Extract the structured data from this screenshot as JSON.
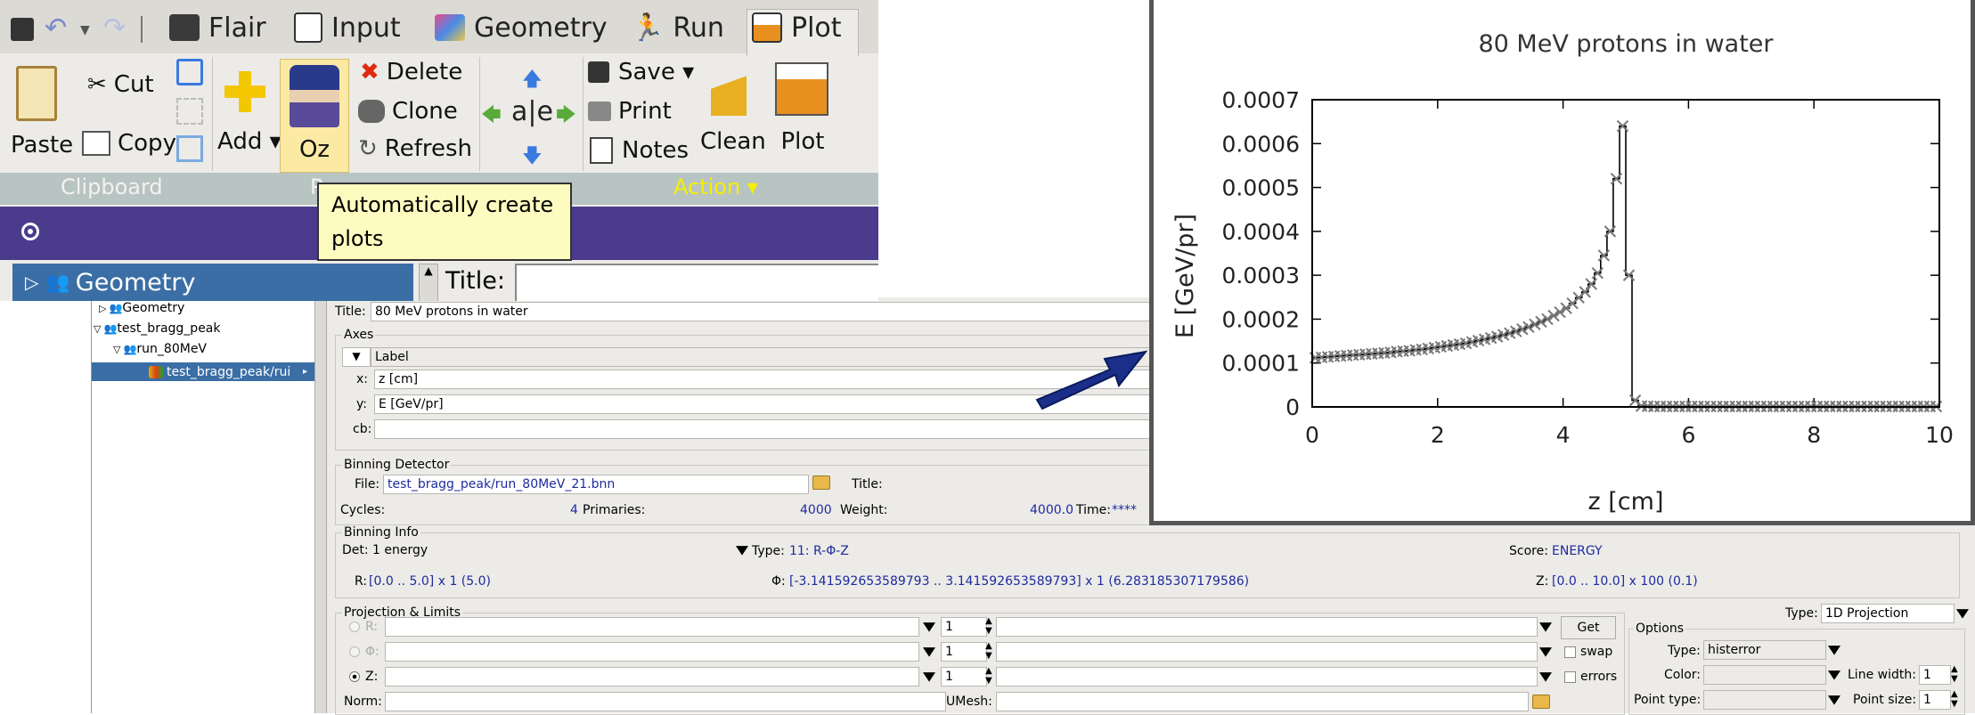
{
  "ribbon": {
    "tabs": [
      {
        "label": "Flair"
      },
      {
        "label": "Input"
      },
      {
        "label": "Geometry"
      },
      {
        "label": "Run"
      },
      {
        "label": "Plot"
      }
    ],
    "clipboard": {
      "paste": "Paste",
      "cut": "Cut",
      "copy": "Copy",
      "group_label": "Clipboard"
    },
    "plot_group": {
      "add": "Add ▾",
      "oz": "Oz",
      "delete": "Delete",
      "clone": "Clone",
      "refresh": "Refresh",
      "group_label_partial": "P"
    },
    "action_group": {
      "save": "Save ▾",
      "print": "Print",
      "notes": "Notes",
      "clean": "Clean",
      "plot": "Plot",
      "group_label": "Action ▾"
    },
    "tooltip": "Automatically create plots",
    "tree_header": "Geometry",
    "title_label": "Title:"
  },
  "tree": {
    "items": [
      {
        "label": "Geometry"
      },
      {
        "label": "test_bragg_peak"
      },
      {
        "label": "run_80MeV"
      },
      {
        "label": "test_bragg_peak/rui"
      }
    ]
  },
  "form": {
    "title_label": "Title:",
    "title_value": "80 MeV protons in water",
    "axes": {
      "legend": "Axes",
      "label_header": "Label",
      "x_label": "x:",
      "x_value": "z [cm]",
      "y_label": "y:",
      "y_value": "E [GeV/pr]",
      "cb_label": "cb:",
      "cb_value": ""
    },
    "binning_detector": {
      "legend": "Binning Detector",
      "file_label": "File:",
      "file_value": "test_bragg_peak/run_80MeV_21.bnn",
      "title_label": "Title:",
      "cycles_label": "Cycles:",
      "cycles_value": "4",
      "primaries_label": "Primaries:",
      "primaries_value": "4000",
      "weight_label": "Weight:",
      "weight_value": "4000.0",
      "time_label": "Time:",
      "time_value": "****"
    },
    "binning_info": {
      "legend": "Binning Info",
      "det_value": "Det: 1 energy",
      "type_label": "Type:",
      "type_value": "11: R-Φ-Z",
      "score_label": "Score:",
      "score_value": "ENERGY",
      "r_label": "R:",
      "r_value": "[0.0 .. 5.0] x 1 (5.0)",
      "phi_label": "Φ:",
      "phi_value": "[-3.141592653589793 .. 3.141592653589793] x 1 (6.283185307179586)",
      "z_label": "Z:",
      "z_value": "[0.0 .. 10.0] x 100 (0.1)"
    },
    "projection": {
      "legend": "Projection & Limits",
      "type_label": "Type:",
      "type_value": "1D Projection",
      "r_label": "R:",
      "phi_label": "Φ:",
      "z_label": "Z:",
      "spin_r": "1",
      "spin_phi": "1",
      "spin_z": "1",
      "get_button": "Get",
      "swap_label": "swap",
      "errors_label": "errors",
      "norm_label": "Norm:",
      "umesh_label": "UMesh:"
    },
    "options": {
      "legend": "Options",
      "type_label": "Type:",
      "type_value": "histerror",
      "color_label": "Color:",
      "line_width_label": "Line width:",
      "line_width_value": "1",
      "point_type_label": "Point type:",
      "point_size_label": "Point size:",
      "point_size_value": "1"
    }
  },
  "colors": {
    "accent_purple": "#4b3b8c",
    "tree_selected": "#3a6ea5",
    "arrow": "#1a2e8a",
    "link": "#1d2b9e"
  },
  "chart_data": {
    "type": "line",
    "title": "80 MeV protons in water",
    "xlabel": "z [cm]",
    "ylabel": "E [GeV/pr]",
    "xlim": [
      0,
      10
    ],
    "ylim": [
      0,
      0.0007
    ],
    "x_ticks": [
      "0",
      "2",
      "4",
      "6",
      "8",
      "10"
    ],
    "y_ticks": [
      "0",
      "0.0001",
      "0.0002",
      "0.0003",
      "0.0004",
      "0.0005",
      "0.0006",
      "0.0007"
    ],
    "marker": "x",
    "x": [
      0.05,
      0.15,
      0.25,
      0.35,
      0.45,
      0.55,
      0.65,
      0.75,
      0.85,
      0.95,
      1.05,
      1.15,
      1.25,
      1.35,
      1.45,
      1.55,
      1.65,
      1.75,
      1.85,
      1.95,
      2.05,
      2.15,
      2.25,
      2.35,
      2.45,
      2.55,
      2.65,
      2.75,
      2.85,
      2.95,
      3.05,
      3.15,
      3.25,
      3.35,
      3.45,
      3.55,
      3.65,
      3.75,
      3.85,
      3.95,
      4.05,
      4.15,
      4.25,
      4.35,
      4.45,
      4.55,
      4.65,
      4.75,
      4.85,
      4.95,
      5.05,
      5.15,
      5.25,
      5.35,
      5.45,
      5.55,
      5.65,
      5.75,
      5.85,
      5.95,
      6.05,
      6.15,
      6.25,
      6.35,
      6.45,
      6.55,
      6.65,
      6.75,
      6.85,
      6.95,
      7.05,
      7.15,
      7.25,
      7.35,
      7.45,
      7.55,
      7.65,
      7.75,
      7.85,
      7.95,
      8.05,
      8.15,
      8.25,
      8.35,
      8.45,
      8.55,
      8.65,
      8.75,
      8.85,
      8.95,
      9.05,
      9.15,
      9.25,
      9.35,
      9.45,
      9.55,
      9.65,
      9.75,
      9.85,
      9.95
    ],
    "values": [
      0.000112,
      0.000113,
      0.000114,
      0.000115,
      0.000116,
      0.000117,
      0.000118,
      0.000119,
      0.00012,
      0.000121,
      0.000122,
      0.000123,
      0.000124,
      0.000126,
      0.000127,
      0.000128,
      0.00013,
      0.000131,
      0.000133,
      0.000135,
      0.000137,
      0.000139,
      0.000141,
      0.000143,
      0.000145,
      0.000148,
      0.000151,
      0.000154,
      0.000157,
      0.00016,
      0.000164,
      0.000168,
      0.000172,
      0.000177,
      0.000182,
      0.000188,
      0.000194,
      0.0002,
      0.000208,
      0.000216,
      0.000225,
      0.000236,
      0.000249,
      0.000262,
      0.00028,
      0.000305,
      0.000345,
      0.0004,
      0.00052,
      0.00064,
      0.0003,
      1.5e-05,
      2e-06,
      1.5e-06,
      1e-06,
      1e-06,
      1e-06,
      1e-06,
      1e-06,
      1e-06,
      1e-06,
      1e-06,
      1e-06,
      1e-06,
      1e-06,
      1e-06,
      1e-06,
      1e-06,
      1e-06,
      1e-06,
      1e-06,
      1e-06,
      1e-06,
      1e-06,
      1e-06,
      1e-06,
      1e-06,
      1e-06,
      1e-06,
      1e-06,
      1e-06,
      1e-06,
      1e-06,
      1e-06,
      1e-06,
      1e-06,
      1e-06,
      1e-06,
      1e-06,
      1e-06,
      1e-06,
      1e-06,
      1e-06,
      1e-06,
      1e-06,
      1e-06,
      1e-06,
      1e-06,
      1e-06,
      1e-06
    ]
  }
}
